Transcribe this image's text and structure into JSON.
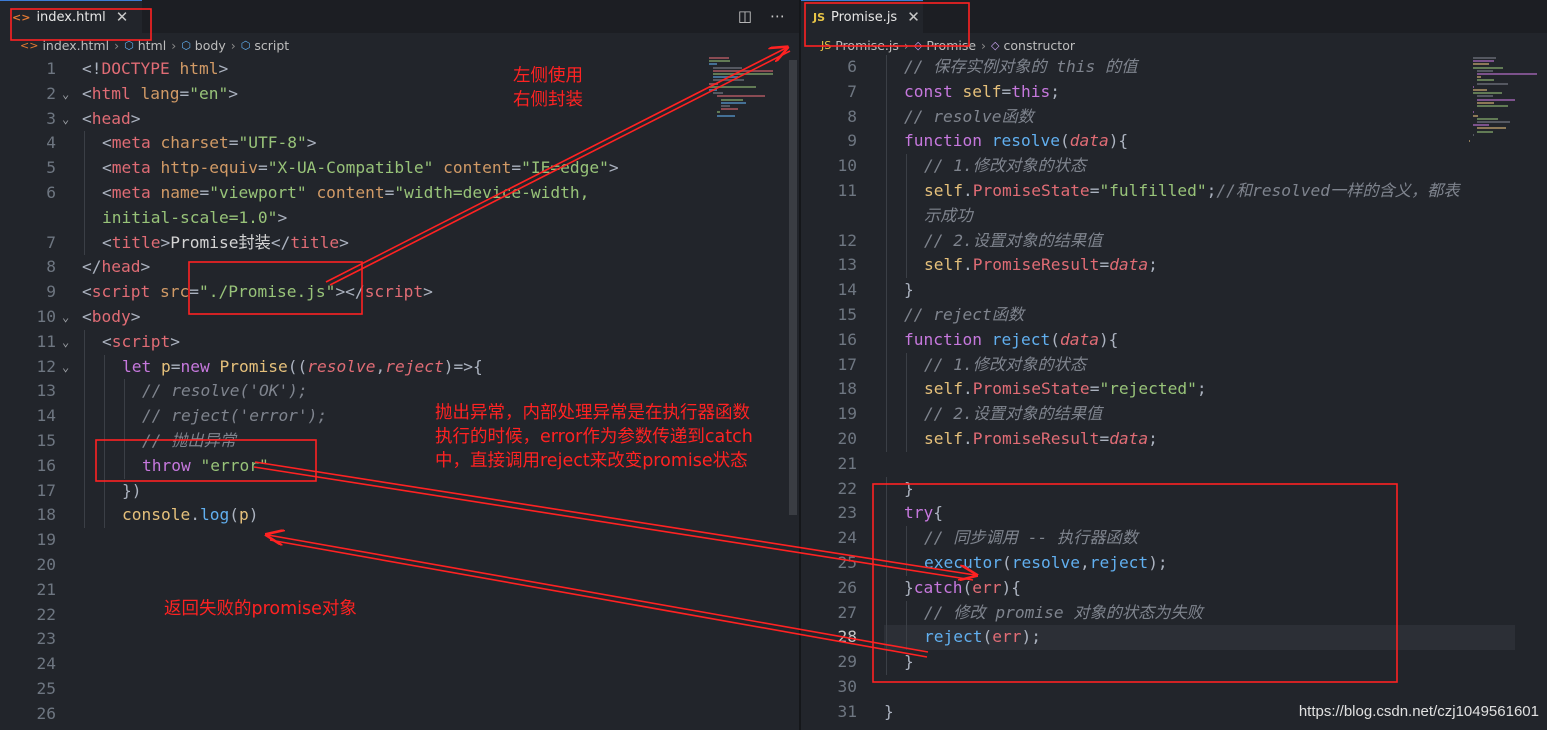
{
  "left_editor": {
    "tab": {
      "icon": "<>",
      "title": "index.html",
      "close": "✕"
    },
    "actions": {
      "split": "◫",
      "more": "⋯"
    },
    "breadcrumbs": [
      {
        "icon": "<>",
        "label": "index.html"
      },
      {
        "icon": "⬡",
        "label": "html"
      },
      {
        "icon": "⬡",
        "label": "body"
      },
      {
        "icon": "⬡",
        "label": "script"
      }
    ],
    "lines": [
      {
        "n": "1",
        "fold": "",
        "indent": 0,
        "tokens": [
          [
            "c-pun",
            "<!"
          ],
          [
            "c-tag",
            "DOCTYPE"
          ],
          [
            "c-plain",
            " "
          ],
          [
            "c-attr",
            "html"
          ],
          [
            "c-pun",
            ">"
          ]
        ]
      },
      {
        "n": "2",
        "fold": "v",
        "indent": 0,
        "tokens": [
          [
            "c-pun",
            "<"
          ],
          [
            "c-tag",
            "html"
          ],
          [
            "c-plain",
            " "
          ],
          [
            "c-attr",
            "lang"
          ],
          [
            "c-pun",
            "="
          ],
          [
            "c-str",
            "\"en\""
          ],
          [
            "c-pun",
            ">"
          ]
        ]
      },
      {
        "n": "3",
        "fold": "v",
        "indent": 0,
        "tokens": [
          [
            "c-pun",
            "<"
          ],
          [
            "c-tag",
            "head"
          ],
          [
            "c-pun",
            ">"
          ]
        ]
      },
      {
        "n": "4",
        "fold": "",
        "indent": 1,
        "tokens": [
          [
            "c-pun",
            "<"
          ],
          [
            "c-tag",
            "meta"
          ],
          [
            "c-plain",
            " "
          ],
          [
            "c-attr",
            "charset"
          ],
          [
            "c-pun",
            "="
          ],
          [
            "c-str",
            "\"UTF-8\""
          ],
          [
            "c-pun",
            ">"
          ]
        ]
      },
      {
        "n": "5",
        "fold": "",
        "indent": 1,
        "tokens": [
          [
            "c-pun",
            "<"
          ],
          [
            "c-tag",
            "meta"
          ],
          [
            "c-plain",
            " "
          ],
          [
            "c-attr",
            "http-equiv"
          ],
          [
            "c-pun",
            "="
          ],
          [
            "c-str",
            "\"X-UA-Compatible\""
          ],
          [
            "c-plain",
            " "
          ],
          [
            "c-attr",
            "content"
          ],
          [
            "c-pun",
            "="
          ],
          [
            "c-str",
            "\"IE=edge\""
          ],
          [
            "c-pun",
            ">"
          ]
        ]
      },
      {
        "n": "6",
        "fold": "",
        "indent": 1,
        "tokens": [
          [
            "c-pun",
            "<"
          ],
          [
            "c-tag",
            "meta"
          ],
          [
            "c-plain",
            " "
          ],
          [
            "c-attr",
            "name"
          ],
          [
            "c-pun",
            "="
          ],
          [
            "c-str",
            "\"viewport\""
          ],
          [
            "c-plain",
            " "
          ],
          [
            "c-attr",
            "content"
          ],
          [
            "c-pun",
            "="
          ],
          [
            "c-str",
            "\"width=device-width,"
          ]
        ]
      },
      {
        "n": "",
        "fold": "",
        "indent": 1,
        "tokens": [
          [
            "c-str",
            "initial-scale=1.0\""
          ],
          [
            "c-pun",
            ">"
          ]
        ]
      },
      {
        "n": "7",
        "fold": "",
        "indent": 1,
        "tokens": [
          [
            "c-pun",
            "<"
          ],
          [
            "c-tag",
            "title"
          ],
          [
            "c-pun",
            ">"
          ],
          [
            "c-plain",
            "Promise封装"
          ],
          [
            "c-pun",
            "</"
          ],
          [
            "c-tag",
            "title"
          ],
          [
            "c-pun",
            ">"
          ]
        ]
      },
      {
        "n": "8",
        "fold": "",
        "indent": 0,
        "tokens": [
          [
            "c-pun",
            "</"
          ],
          [
            "c-tag",
            "head"
          ],
          [
            "c-pun",
            ">"
          ]
        ]
      },
      {
        "n": "9",
        "fold": "",
        "indent": 0,
        "tokens": [
          [
            "c-pun",
            "<"
          ],
          [
            "c-tag",
            "script"
          ],
          [
            "c-plain",
            " "
          ],
          [
            "c-attr",
            "src"
          ],
          [
            "c-pun",
            "="
          ],
          [
            "c-str",
            "\"./Promise.js\""
          ],
          [
            "c-pun",
            "></"
          ],
          [
            "c-tag",
            "script"
          ],
          [
            "c-pun",
            ">"
          ]
        ]
      },
      {
        "n": "10",
        "fold": "v",
        "indent": 0,
        "tokens": [
          [
            "c-pun",
            "<"
          ],
          [
            "c-tag",
            "body"
          ],
          [
            "c-pun",
            ">"
          ]
        ]
      },
      {
        "n": "11",
        "fold": "v",
        "indent": 1,
        "tokens": [
          [
            "c-pun",
            "<"
          ],
          [
            "c-tag",
            "script"
          ],
          [
            "c-pun",
            ">"
          ]
        ]
      },
      {
        "n": "12",
        "fold": "v",
        "indent": 2,
        "tokens": [
          [
            "c-kw",
            "let"
          ],
          [
            "c-plain",
            " "
          ],
          [
            "c-ident",
            "p"
          ],
          [
            "c-pun",
            "="
          ],
          [
            "c-kw",
            "new"
          ],
          [
            "c-plain",
            " "
          ],
          [
            "c-cls",
            "Promise"
          ],
          [
            "c-pun",
            "(("
          ],
          [
            "c-par",
            "resolve"
          ],
          [
            "c-pun",
            ","
          ],
          [
            "c-par",
            "reject"
          ],
          [
            "c-pun",
            ")=>{"
          ]
        ]
      },
      {
        "n": "13",
        "fold": "",
        "indent": 3,
        "tokens": [
          [
            "c-com",
            "// resolve('OK');"
          ]
        ]
      },
      {
        "n": "14",
        "fold": "",
        "indent": 3,
        "tokens": [
          [
            "c-com",
            "// reject('error');"
          ]
        ]
      },
      {
        "n": "15",
        "fold": "",
        "indent": 3,
        "tokens": [
          [
            "c-com",
            "// 抛出异常"
          ]
        ]
      },
      {
        "n": "16",
        "fold": "",
        "indent": 3,
        "tokens": [
          [
            "c-kw",
            "throw"
          ],
          [
            "c-plain",
            " "
          ],
          [
            "c-str",
            "\"error\""
          ]
        ]
      },
      {
        "n": "17",
        "fold": "",
        "indent": 2,
        "tokens": [
          [
            "c-pun",
            "})"
          ]
        ]
      },
      {
        "n": "18",
        "fold": "",
        "indent": 2,
        "tokens": [
          [
            "c-obj",
            "console"
          ],
          [
            "c-pun",
            "."
          ],
          [
            "c-fn",
            "log"
          ],
          [
            "c-pun",
            "("
          ],
          [
            "c-ident",
            "p"
          ],
          [
            "c-pun",
            ")"
          ]
        ]
      },
      {
        "n": "19",
        "fold": "",
        "indent": 0,
        "tokens": []
      },
      {
        "n": "20",
        "fold": "",
        "indent": 0,
        "tokens": []
      },
      {
        "n": "21",
        "fold": "",
        "indent": 0,
        "tokens": []
      },
      {
        "n": "22",
        "fold": "",
        "indent": 0,
        "tokens": []
      },
      {
        "n": "23",
        "fold": "",
        "indent": 0,
        "tokens": []
      },
      {
        "n": "24",
        "fold": "",
        "indent": 0,
        "tokens": []
      },
      {
        "n": "25",
        "fold": "",
        "indent": 0,
        "tokens": []
      },
      {
        "n": "26",
        "fold": "",
        "indent": 0,
        "tokens": []
      }
    ]
  },
  "right_editor": {
    "tab": {
      "icon": "JS",
      "title": "Promise.js",
      "close": "✕"
    },
    "breadcrumbs": [
      {
        "icon": "JS",
        "label": "Promise.js"
      },
      {
        "icon": "◇",
        "label": "Promise"
      },
      {
        "icon": "◇",
        "label": "constructor"
      }
    ],
    "lines": [
      {
        "n": "6",
        "indent": 1,
        "tokens": [
          [
            "c-com",
            "// 保存实例对象的 this 的值"
          ]
        ]
      },
      {
        "n": "7",
        "indent": 1,
        "tokens": [
          [
            "c-kw",
            "const"
          ],
          [
            "c-plain",
            " "
          ],
          [
            "c-ident",
            "self"
          ],
          [
            "c-pun",
            "="
          ],
          [
            "c-kw",
            "this"
          ],
          [
            "c-pun",
            ";"
          ]
        ]
      },
      {
        "n": "8",
        "indent": 1,
        "tokens": [
          [
            "c-com",
            "// resolve函数"
          ]
        ]
      },
      {
        "n": "9",
        "indent": 1,
        "tokens": [
          [
            "c-kw",
            "function"
          ],
          [
            "c-plain",
            " "
          ],
          [
            "c-fn",
            "resolve"
          ],
          [
            "c-pun",
            "("
          ],
          [
            "c-par",
            "data"
          ],
          [
            "c-pun",
            "){"
          ]
        ]
      },
      {
        "n": "10",
        "indent": 2,
        "tokens": [
          [
            "c-com",
            "// 1.修改对象的状态"
          ]
        ]
      },
      {
        "n": "11",
        "indent": 2,
        "tokens": [
          [
            "c-ident",
            "self"
          ],
          [
            "c-pun",
            "."
          ],
          [
            "c-prop",
            "PromiseState"
          ],
          [
            "c-pun",
            "="
          ],
          [
            "c-str",
            "\"fulfilled\""
          ],
          [
            "c-pun",
            ";"
          ],
          [
            "c-com",
            "//和resolved一样的含义，都表"
          ]
        ]
      },
      {
        "n": "",
        "indent": 2,
        "tokens": [
          [
            "c-com",
            "示成功"
          ]
        ]
      },
      {
        "n": "12",
        "indent": 2,
        "tokens": [
          [
            "c-com",
            "// 2.设置对象的结果值"
          ]
        ]
      },
      {
        "n": "13",
        "indent": 2,
        "tokens": [
          [
            "c-ident",
            "self"
          ],
          [
            "c-pun",
            "."
          ],
          [
            "c-prop",
            "PromiseResult"
          ],
          [
            "c-pun",
            "="
          ],
          [
            "c-par",
            "data"
          ],
          [
            "c-pun",
            ";"
          ]
        ]
      },
      {
        "n": "14",
        "indent": 1,
        "tokens": [
          [
            "c-pun",
            "}"
          ]
        ]
      },
      {
        "n": "15",
        "indent": 1,
        "tokens": [
          [
            "c-com",
            "// reject函数"
          ]
        ]
      },
      {
        "n": "16",
        "indent": 1,
        "tokens": [
          [
            "c-kw",
            "function"
          ],
          [
            "c-plain",
            " "
          ],
          [
            "c-fn",
            "reject"
          ],
          [
            "c-pun",
            "("
          ],
          [
            "c-par",
            "data"
          ],
          [
            "c-pun",
            "){"
          ]
        ]
      },
      {
        "n": "17",
        "indent": 2,
        "tokens": [
          [
            "c-com",
            "// 1.修改对象的状态"
          ]
        ]
      },
      {
        "n": "18",
        "indent": 2,
        "tokens": [
          [
            "c-ident",
            "self"
          ],
          [
            "c-pun",
            "."
          ],
          [
            "c-prop",
            "PromiseState"
          ],
          [
            "c-pun",
            "="
          ],
          [
            "c-str",
            "\"rejected\""
          ],
          [
            "c-pun",
            ";"
          ]
        ]
      },
      {
        "n": "19",
        "indent": 2,
        "tokens": [
          [
            "c-com",
            "// 2.设置对象的结果值"
          ]
        ]
      },
      {
        "n": "20",
        "indent": 2,
        "tokens": [
          [
            "c-ident",
            "self"
          ],
          [
            "c-pun",
            "."
          ],
          [
            "c-prop",
            "PromiseResult"
          ],
          [
            "c-pun",
            "="
          ],
          [
            "c-par",
            "data"
          ],
          [
            "c-pun",
            ";"
          ]
        ]
      },
      {
        "n": "21",
        "indent": 0,
        "tokens": []
      },
      {
        "n": "22",
        "indent": 1,
        "tokens": [
          [
            "c-pun",
            "}"
          ]
        ]
      },
      {
        "n": "23",
        "indent": 1,
        "tokens": [
          [
            "c-kw",
            "try"
          ],
          [
            "c-pun",
            "{"
          ]
        ]
      },
      {
        "n": "24",
        "indent": 2,
        "tokens": [
          [
            "c-com",
            "// 同步调用 -- 执行器函数"
          ]
        ]
      },
      {
        "n": "25",
        "indent": 2,
        "tokens": [
          [
            "c-fn",
            "executor"
          ],
          [
            "c-pun",
            "("
          ],
          [
            "c-fn",
            "resolve"
          ],
          [
            "c-pun",
            ","
          ],
          [
            "c-fn",
            "reject"
          ],
          [
            "c-pun",
            ");"
          ]
        ]
      },
      {
        "n": "26",
        "indent": 1,
        "tokens": [
          [
            "c-pun",
            "}"
          ],
          [
            "c-kw",
            "catch"
          ],
          [
            "c-pun",
            "("
          ],
          [
            "c-prop",
            "err"
          ],
          [
            "c-pun",
            "){"
          ]
        ]
      },
      {
        "n": "27",
        "indent": 2,
        "tokens": [
          [
            "c-com",
            "// 修改 promise 对象的状态为失败"
          ]
        ]
      },
      {
        "n": "28",
        "indent": 2,
        "tokens": [
          [
            "c-fn",
            "reject"
          ],
          [
            "c-pun",
            "("
          ],
          [
            "c-prop",
            "err"
          ],
          [
            "c-pun",
            ");"
          ]
        ]
      },
      {
        "n": "29",
        "indent": 1,
        "tokens": [
          [
            "c-pun",
            "}"
          ]
        ]
      },
      {
        "n": "30",
        "indent": 0,
        "tokens": []
      },
      {
        "n": "31",
        "indent": 0,
        "tokens": [
          [
            "c-pun",
            "}"
          ]
        ]
      }
    ]
  },
  "annotations": {
    "left_use_right_wrap": "左侧使用\n右侧封装",
    "throw_explain": "抛出异常，内部处理异常是在执行器函数\n执行的时候，error作为参数传递到catch\n中，直接调用reject来改变promise状态",
    "return_failed": "返回失败的promise对象"
  },
  "watermark": "https://blog.csdn.net/czj1049561601",
  "colors": {
    "background": "#22252b",
    "annotation": "#ff2222",
    "tab_border": "#3c7bd6",
    "js_icon": "#e8c547",
    "html_icon": "#e37933"
  }
}
